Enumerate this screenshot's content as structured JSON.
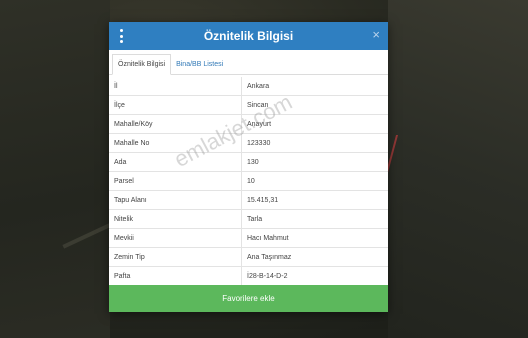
{
  "modal": {
    "title": "Öznitelik Bilgisi",
    "close_symbol": "×",
    "menu_icon": "kebab-menu-icon",
    "tabs": [
      {
        "label": "Öznitelik Bilgisi",
        "active": true
      },
      {
        "label": "Bina/BB Listesi",
        "active": false
      }
    ],
    "rows": [
      {
        "key": "İl",
        "value": "Ankara"
      },
      {
        "key": "İlçe",
        "value": "Sincan"
      },
      {
        "key": "Mahalle/Köy",
        "value": "Anayurt"
      },
      {
        "key": "Mahalle No",
        "value": "123330"
      },
      {
        "key": "Ada",
        "value": "130"
      },
      {
        "key": "Parsel",
        "value": "10"
      },
      {
        "key": "Tapu Alanı",
        "value": "15.415,31"
      },
      {
        "key": "Nitelik",
        "value": "Tarla"
      },
      {
        "key": "Mevkii",
        "value": "Hacı Mahmut"
      },
      {
        "key": "Zemin Tip",
        "value": "Ana Taşınmaz"
      },
      {
        "key": "Pafta",
        "value": "İ28-B-14-D-2"
      }
    ],
    "favorite_button": "Favorilere ekle"
  },
  "watermark": "emlakjet.com",
  "colors": {
    "header": "#2f7fc1",
    "favorite_button": "#5cb85c"
  }
}
